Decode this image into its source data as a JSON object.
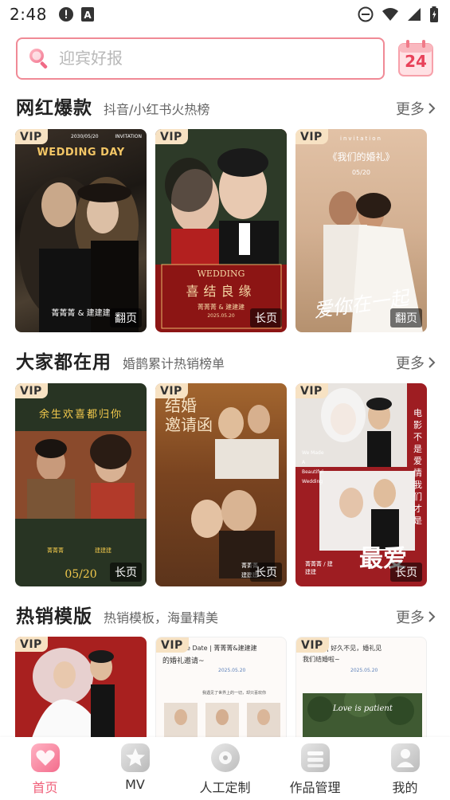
{
  "status_bar": {
    "time": "2:48"
  },
  "search": {
    "placeholder": "迎宾好报",
    "calendar_day": "24"
  },
  "sections": [
    {
      "title": "网红爆款",
      "subtitle": "抖音/小红书火热榜",
      "more": "更多",
      "cards": [
        {
          "badge": "VIP",
          "tag": "翻页",
          "text_1": "WEDDING DAY",
          "text_2": "2030/05/20",
          "text_3": "INVITATION",
          "text_4": "菁菁菁 & 建建建"
        },
        {
          "badge": "VIP",
          "tag": "长页",
          "text_1": "WEDDING",
          "text_2": "喜结良缘",
          "text_3": "菁菁菁 & 建建建",
          "text_4": "2025.05.20"
        },
        {
          "badge": "VIP",
          "tag": "翻页",
          "text_1": "invitation",
          "text_2": "《我们的婚礼》",
          "text_3": "05/20",
          "text_4": "爱你在一起"
        }
      ]
    },
    {
      "title": "大家都在用",
      "subtitle": "婚鹊累计热销榜单",
      "more": "更多",
      "cards": [
        {
          "badge": "VIP",
          "tag": "长页",
          "text_1": "余生欢喜都归你",
          "text_2": "05/20",
          "text_3": "菁菁菁",
          "text_4": "建建建"
        },
        {
          "badge": "VIP",
          "tag": "长页",
          "text_1": "结婚",
          "text_2": "邀请函",
          "text_3": "菁菁菁",
          "text_4": "建建建"
        },
        {
          "badge": "VIP",
          "tag": "长页",
          "text_1": "电影不是爱情我们才是",
          "text_2": "最爱",
          "text_3": "We Made A Beautiful Wedding",
          "text_4": "菁菁菁 / 建建建"
        }
      ]
    },
    {
      "title": "热销模版",
      "subtitle": "热销模板，海量精美",
      "more": "更多",
      "cards": [
        {
          "badge": "VIP"
        },
        {
          "badge": "VIP",
          "text_1": "e Date | 菁菁菁&建建建",
          "text_2": "的婚礼邀请~",
          "text_3": "2025.05.20",
          "text_4": "我遇见了世界上的一切，却只喜欢你"
        },
        {
          "badge": "VIP",
          "text_1": "| 好久不见，婚礼见",
          "text_2": "我们结婚啦~",
          "text_3": "2025.05.20",
          "text_4": "Love is patient"
        }
      ]
    }
  ],
  "tabbar": [
    {
      "label": "首页",
      "active": true
    },
    {
      "label": "MV",
      "active": false
    },
    {
      "label": "人工定制",
      "active": false
    },
    {
      "label": "作品管理",
      "active": false
    },
    {
      "label": "我的",
      "active": false
    }
  ],
  "colors": {
    "accent": "#f0607a",
    "search_border": "#f08a96",
    "vip_bg": "#f7e2c3"
  }
}
